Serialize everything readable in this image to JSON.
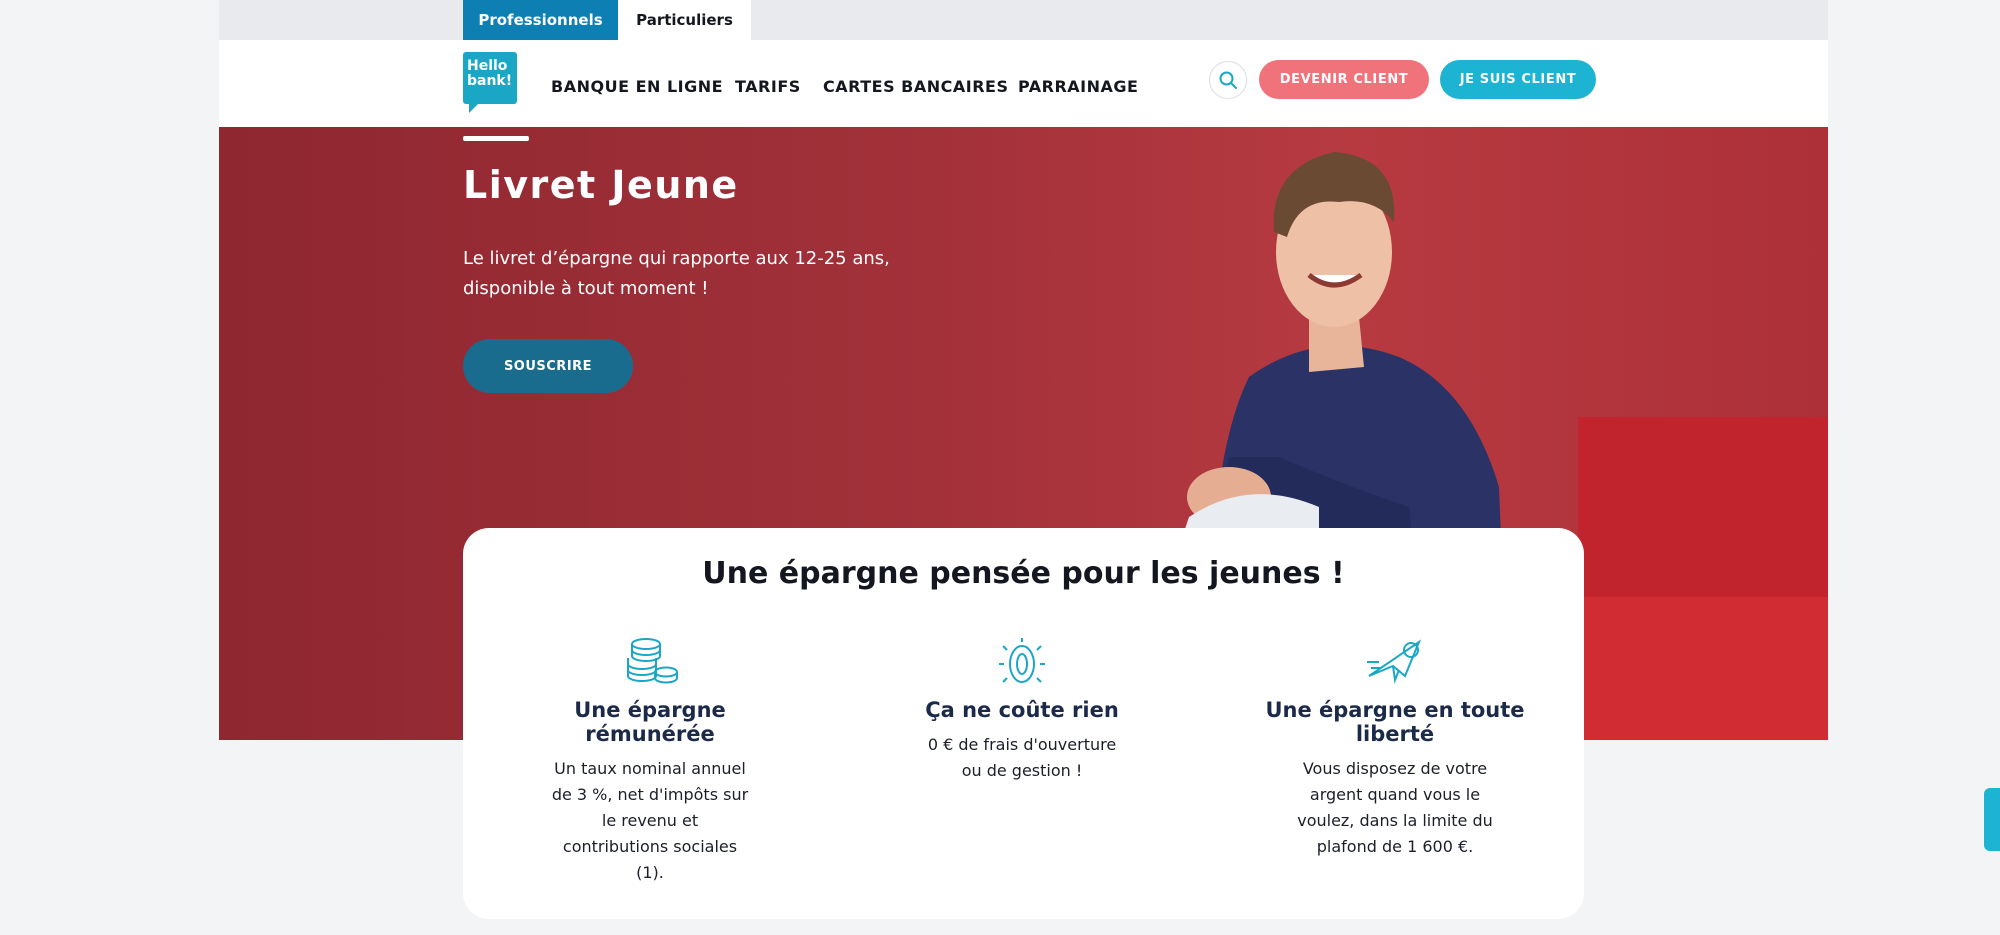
{
  "segments": {
    "pro_label": "Professionnels",
    "particuliers_label": "Particuliers"
  },
  "header": {
    "logo_text": "Hello bank!",
    "nav": [
      "BANQUE EN LIGNE",
      "TARIFS",
      "CARTES BANCAIRES",
      "PARRAINAGE"
    ],
    "devenir_label": "DEVENIR CLIENT",
    "suis_label": "JE SUIS CLIENT"
  },
  "hero": {
    "title": "Livret Jeune",
    "subtitle": "Le livret d’épargne qui rapporte aux 12-25 ans, disponible à tout moment !",
    "cta_label": "SOUSCRIRE"
  },
  "card": {
    "title": "Une épargne pensée pour les jeunes !",
    "features": [
      {
        "icon": "coins-icon",
        "title": "Une épargne rémunérée",
        "text": "Un taux nominal annuel de 3 %, net d'impôts sur le revenu et contributions sociales (1)."
      },
      {
        "icon": "zero-coin-icon",
        "title": "Ça ne coûte rien",
        "text": "0 € de frais d'ouverture ou de gestion !"
      },
      {
        "icon": "flying-coin-icon",
        "title": "Une épargne en toute liberté",
        "text": "Vous disposez de votre argent quand vous le voulez, dans la limite du plafond de 1 600 €."
      }
    ]
  },
  "colors": {
    "brand_blue": "#0d7fb2",
    "accent_cyan": "#1db3d3",
    "accent_pink": "#f0727a",
    "hero_red": "#a3313a",
    "cta_teal": "#1a6c8f"
  }
}
